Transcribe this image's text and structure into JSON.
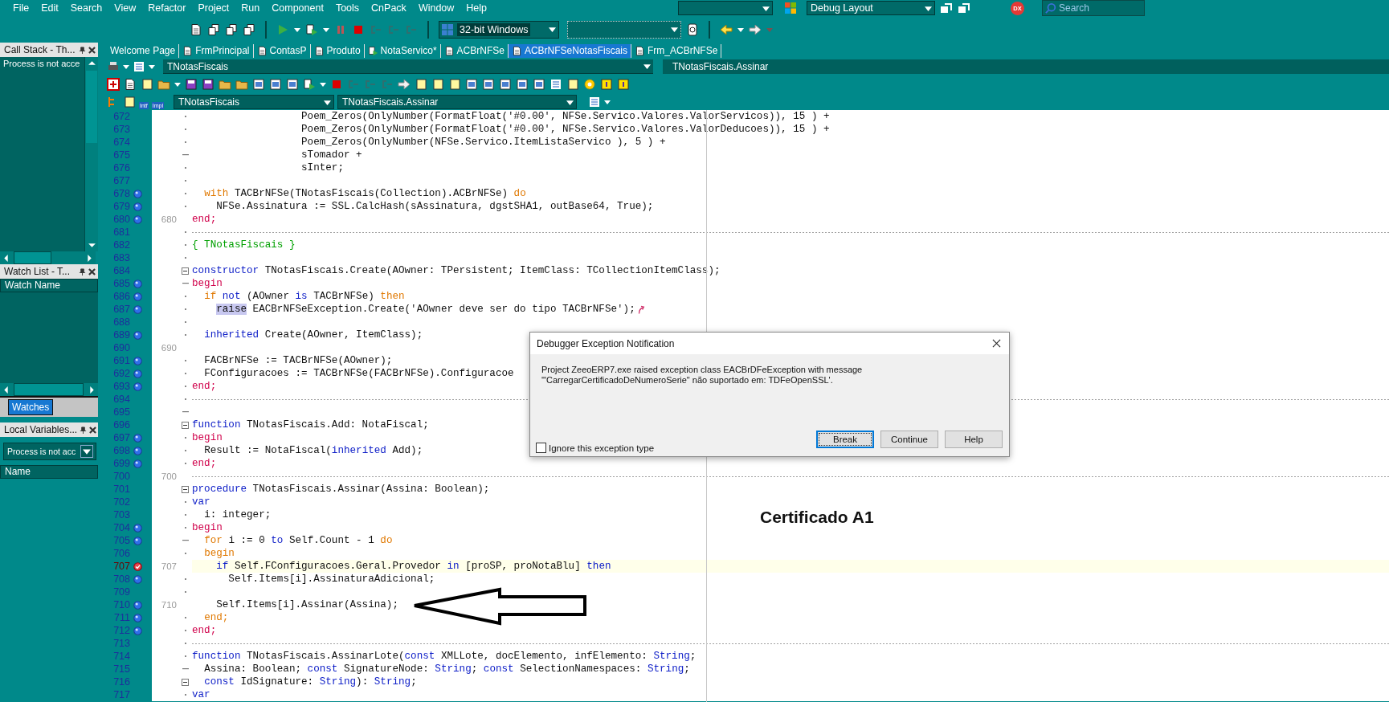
{
  "menu": [
    "File",
    "Edit",
    "Search",
    "View",
    "Refactor",
    "Project",
    "Run",
    "Component",
    "Tools",
    "CnPack",
    "Window",
    "Help"
  ],
  "top_right": {
    "layout_combo": "Debug Layout",
    "dx_badge": "DX",
    "search": {
      "placeholder": "Search"
    }
  },
  "toolbar": {
    "platform_combo": "32-bit Windows"
  },
  "tabs": [
    {
      "label": "Welcome Page",
      "kind": "plain",
      "selected": false
    },
    {
      "label": "FrmPrincipal",
      "kind": "form",
      "selected": false
    },
    {
      "label": "ContasP",
      "kind": "form",
      "selected": false
    },
    {
      "label": "Produto",
      "kind": "form",
      "selected": false
    },
    {
      "label": "NotaServico*",
      "kind": "edited",
      "selected": false
    },
    {
      "label": "ACBrNFSe",
      "kind": "unit",
      "selected": false
    },
    {
      "label": "ACBrNFSeNotasFiscais",
      "kind": "unit",
      "selected": true
    },
    {
      "label": "Frm_ACBrNFSe",
      "kind": "unit",
      "selected": false
    }
  ],
  "left": {
    "call_stack": {
      "title": "Call Stack - Th...",
      "message": "Process is not acce"
    },
    "watch_list": {
      "title": "Watch List - T...",
      "column": "Watch Name",
      "tabs": [
        {
          "label": "Watches",
          "selected": true
        }
      ]
    },
    "local_variables": {
      "title": "Local Variables...",
      "combo": "Process is not acc",
      "column": "Name"
    }
  },
  "editor": {
    "unit_combo": "TNotasFiscais",
    "method_label": "TNotasFiscais.Assinar",
    "nav_icons": [
      "Intf",
      "Impl"
    ],
    "class_combo": "TNotasFiscais",
    "method_combo": "TNotasFiscais.Assinar",
    "lines": [
      {
        "n": "672",
        "fold": {
          "kind": "dot"
        },
        "current": false,
        "code": [
          {
            "kind": "plain",
            "text": "                  Poem_Zeros(OnlyNumber(FormatFloat('#0.00', NFSe.Servico.Valores.ValorServicos)), 15 ) +"
          }
        ]
      },
      {
        "n": "673",
        "fold": {
          "kind": "dot"
        },
        "current": false,
        "code": [
          {
            "kind": "plain",
            "text": "                  Poem_Zeros(OnlyNumber(FormatFloat('#0.00', NFSe.Servico.Valores.ValorDeducoes)), 15 ) +"
          }
        ]
      },
      {
        "n": "674",
        "fold": {
          "kind": "dot"
        },
        "current": false,
        "code": [
          {
            "kind": "plain",
            "text": "                  Poem_Zeros(OnlyNumber(NFSe.Servico.ItemListaServico ), 5 ) +"
          }
        ]
      },
      {
        "n": "675",
        "fold": {
          "kind": "dash"
        },
        "current": false,
        "code": [
          {
            "kind": "plain",
            "text": "                  sTomador +"
          }
        ]
      },
      {
        "n": "676",
        "fold": {
          "kind": "dot"
        },
        "current": false,
        "code": [
          {
            "kind": "plain",
            "text": "                  sInter;"
          }
        ]
      },
      {
        "n": "677",
        "fold": {
          "kind": "dot"
        },
        "current": false
      },
      {
        "n": "678",
        "marker": {
          "kind": "dot"
        },
        "fold": {
          "kind": "dot"
        },
        "current": false,
        "code": [
          {
            "kind": "ctl",
            "text": "  with"
          },
          {
            "kind": "plain",
            "text": " TACBrNFSe(TNotasFiscais(Collection).ACBrNFSe) "
          },
          {
            "kind": "ctl",
            "text": "do"
          }
        ]
      },
      {
        "n": "679",
        "marker": {
          "kind": "dot"
        },
        "fold": {
          "kind": "dot"
        },
        "current": false,
        "code": [
          {
            "kind": "plain",
            "text": "    NFSe.Assinatura := SSL.CalcHash(sAssinatura, dgstSHA1, outBase64, True);"
          }
        ]
      },
      {
        "n": "680",
        "marker": {
          "kind": "dot"
        },
        "label": "680",
        "current": false,
        "code": [
          {
            "kind": "blk",
            "text": "end;"
          }
        ]
      },
      {
        "n": "681",
        "fold": {
          "kind": "dot"
        },
        "separator": true,
        "current": false
      },
      {
        "n": "682",
        "fold": {
          "kind": "dot"
        },
        "current": false,
        "code": [
          {
            "kind": "cmt",
            "text": "{ TNotasFiscais }"
          }
        ]
      },
      {
        "n": "683",
        "fold": {
          "kind": "dot"
        },
        "current": false
      },
      {
        "n": "684",
        "fold": {
          "kind": "box"
        },
        "current": false,
        "code": [
          {
            "kind": "kw",
            "text": "constructor"
          },
          {
            "kind": "plain",
            "text": " TNotasFiscais.Create(AOwner: TPersistent; ItemClass: TCollectionItemClass);"
          }
        ]
      },
      {
        "n": "685",
        "marker": {
          "kind": "dot"
        },
        "fold": {
          "kind": "dash"
        },
        "current": false,
        "code": [
          {
            "kind": "blk",
            "text": "begin"
          }
        ]
      },
      {
        "n": "686",
        "marker": {
          "kind": "dot"
        },
        "fold": {
          "kind": "dot"
        },
        "current": false,
        "code": [
          {
            "kind": "ctl",
            "text": "  if"
          },
          {
            "kind": "kw",
            "text": " not"
          },
          {
            "kind": "plain",
            "text": " (AOwner "
          },
          {
            "kind": "kw",
            "text": "is"
          },
          {
            "kind": "plain",
            "text": " TACBrNFSe) "
          },
          {
            "kind": "ctl",
            "text": "then"
          }
        ]
      },
      {
        "n": "687",
        "marker": {
          "kind": "dot"
        },
        "fold": {
          "kind": "dot"
        },
        "trail": {
          "kind": "arrow"
        },
        "current": false,
        "code": [
          {
            "kind": "hl",
            "text": "    raise"
          },
          {
            "kind": "plain",
            "text": " EACBrNFSeException.Create('AOwner deve ser do tipo TACBrNFSe');"
          }
        ]
      },
      {
        "n": "688",
        "fold": {
          "kind": "dot"
        },
        "current": false
      },
      {
        "n": "689",
        "marker": {
          "kind": "dot"
        },
        "fold": {
          "kind": "dot"
        },
        "current": false,
        "code": [
          {
            "kind": "kw",
            "text": "  inherited"
          },
          {
            "kind": "plain",
            "text": " Create(AOwner, ItemClass);"
          }
        ]
      },
      {
        "n": "690",
        "label": "690",
        "current": false
      },
      {
        "n": "691",
        "marker": {
          "kind": "dot"
        },
        "fold": {
          "kind": "dot"
        },
        "current": false,
        "code": [
          {
            "kind": "plain",
            "text": "  FACBrNFSe := TACBrNFSe(AOwner);"
          }
        ]
      },
      {
        "n": "692",
        "marker": {
          "kind": "dot"
        },
        "fold": {
          "kind": "dot"
        },
        "current": false,
        "code": [
          {
            "kind": "plain",
            "text": "  FConfiguracoes := TACBrNFSe(FACBrNFSe).Configuracoe"
          }
        ]
      },
      {
        "n": "693",
        "marker": {
          "kind": "dot"
        },
        "fold": {
          "kind": "dot"
        },
        "current": false,
        "code": [
          {
            "kind": "blk",
            "text": "end;"
          }
        ]
      },
      {
        "n": "694",
        "fold": {
          "kind": "dot"
        },
        "separator": true,
        "current": false
      },
      {
        "n": "695",
        "fold": {
          "kind": "dash"
        },
        "current": false
      },
      {
        "n": "696",
        "fold": {
          "kind": "box"
        },
        "current": false,
        "code": [
          {
            "kind": "kw",
            "text": "function"
          },
          {
            "kind": "plain",
            "text": " TNotasFiscais.Add: NotaFiscal;"
          }
        ]
      },
      {
        "n": "697",
        "marker": {
          "kind": "dot"
        },
        "fold": {
          "kind": "dot"
        },
        "current": false,
        "code": [
          {
            "kind": "blk",
            "text": "begin"
          }
        ]
      },
      {
        "n": "698",
        "marker": {
          "kind": "dot"
        },
        "fold": {
          "kind": "dot"
        },
        "current": false,
        "code": [
          {
            "kind": "plain",
            "text": "  Result := NotaFiscal("
          },
          {
            "kind": "kw",
            "text": "inherited"
          },
          {
            "kind": "plain",
            "text": " Add);"
          }
        ]
      },
      {
        "n": "699",
        "marker": {
          "kind": "dot"
        },
        "fold": {
          "kind": "dot"
        },
        "current": false,
        "code": [
          {
            "kind": "blk",
            "text": "end;"
          }
        ]
      },
      {
        "n": "700",
        "label": "700",
        "separator": true,
        "current": false
      },
      {
        "n": "701",
        "fold": {
          "kind": "box"
        },
        "current": false,
        "code": [
          {
            "kind": "kw",
            "text": "procedure"
          },
          {
            "kind": "plain",
            "text": " TNotasFiscais.Assinar(Assina: Boolean);"
          }
        ]
      },
      {
        "n": "702",
        "fold": {
          "kind": "dot"
        },
        "current": false,
        "code": [
          {
            "kind": "kw",
            "text": "var"
          }
        ]
      },
      {
        "n": "703",
        "fold": {
          "kind": "dot"
        },
        "current": false,
        "code": [
          {
            "kind": "plain",
            "text": "  i: integer;"
          }
        ]
      },
      {
        "n": "704",
        "marker": {
          "kind": "dot"
        },
        "fold": {
          "kind": "dot"
        },
        "current": false,
        "code": [
          {
            "kind": "blk",
            "text": "begin"
          }
        ]
      },
      {
        "n": "705",
        "marker": {
          "kind": "dot"
        },
        "fold": {
          "kind": "dash"
        },
        "current": false,
        "code": [
          {
            "kind": "ctl",
            "text": "  for"
          },
          {
            "kind": "plain",
            "text": " i := 0 "
          },
          {
            "kind": "kw",
            "text": "to"
          },
          {
            "kind": "plain",
            "text": " Self.Count - 1 "
          },
          {
            "kind": "ctl",
            "text": "do"
          }
        ]
      },
      {
        "n": "706",
        "fold": {
          "kind": "dot"
        },
        "current": false,
        "code": [
          {
            "kind": "ctl",
            "text": "  begin"
          }
        ]
      },
      {
        "n": "707",
        "marker": {
          "kind": "breakpoint"
        },
        "label": "707",
        "current": true,
        "code": [
          {
            "kind": "kw",
            "text": "    if"
          },
          {
            "kind": "plain",
            "text": " Self.FConfiguracoes.Geral.Provedor "
          },
          {
            "kind": "kw",
            "text": "in"
          },
          {
            "kind": "plain",
            "text": " [proSP, proNotaBlu] "
          },
          {
            "kind": "kw",
            "text": "then"
          }
        ]
      },
      {
        "n": "708",
        "marker": {
          "kind": "dot"
        },
        "fold": {
          "kind": "dot"
        },
        "current": false,
        "code": [
          {
            "kind": "plain",
            "text": "      Self.Items[i].AssinaturaAdicional;"
          }
        ]
      },
      {
        "n": "709",
        "fold": {
          "kind": "dot"
        },
        "current": false
      },
      {
        "n": "710",
        "marker": {
          "kind": "dot"
        },
        "label": "710",
        "current": false,
        "code": [
          {
            "kind": "plain",
            "text": "    Self.Items[i].Assinar(Assina);"
          }
        ]
      },
      {
        "n": "711",
        "marker": {
          "kind": "dot"
        },
        "fold": {
          "kind": "dot"
        },
        "current": false,
        "code": [
          {
            "kind": "ctl",
            "text": "  end;"
          }
        ]
      },
      {
        "n": "712",
        "marker": {
          "kind": "dot"
        },
        "fold": {
          "kind": "dot"
        },
        "current": false,
        "code": [
          {
            "kind": "blk",
            "text": "end;"
          }
        ]
      },
      {
        "n": "713",
        "fold": {
          "kind": "dot"
        },
        "separator": true,
        "current": false
      },
      {
        "n": "714",
        "fold": {
          "kind": "dot"
        },
        "current": false,
        "code": [
          {
            "kind": "kw",
            "text": "function"
          },
          {
            "kind": "plain",
            "text": " TNotasFiscais.AssinarLote("
          },
          {
            "kind": "kw",
            "text": "const"
          },
          {
            "kind": "plain",
            "text": " XMLLote, docElemento, infElemento: "
          },
          {
            "kind": "kw",
            "text": "String"
          },
          {
            "kind": "plain",
            "text": ";"
          }
        ]
      },
      {
        "n": "715",
        "fold": {
          "kind": "dash"
        },
        "current": false,
        "code": [
          {
            "kind": "plain",
            "text": "  Assina: Boolean; "
          },
          {
            "kind": "kw",
            "text": "const"
          },
          {
            "kind": "plain",
            "text": " SignatureNode: "
          },
          {
            "kind": "kw",
            "text": "String"
          },
          {
            "kind": "plain",
            "text": "; "
          },
          {
            "kind": "kw",
            "text": "const"
          },
          {
            "kind": "plain",
            "text": " SelectionNamespaces: "
          },
          {
            "kind": "kw",
            "text": "String"
          },
          {
            "kind": "plain",
            "text": ";"
          }
        ]
      },
      {
        "n": "716",
        "fold": {
          "kind": "box"
        },
        "current": false,
        "code": [
          {
            "kind": "kw",
            "text": "  const"
          },
          {
            "kind": "plain",
            "text": " IdSignature: "
          },
          {
            "kind": "kw",
            "text": "String"
          },
          {
            "kind": "plain",
            "text": "): "
          },
          {
            "kind": "kw",
            "text": "String"
          },
          {
            "kind": "plain",
            "text": ";"
          }
        ]
      },
      {
        "n": "717",
        "fold": {
          "kind": "dot"
        },
        "current": false,
        "code": [
          {
            "kind": "kw",
            "text": "var"
          }
        ]
      }
    ]
  },
  "annotation": "Certificado A1",
  "dialog": {
    "title": "Debugger Exception Notification",
    "message": [
      "Project ZeeoERP7.exe raised exception class EACBrDFeException with message",
      "'\"CarregarCertificadoDeNumeroSerie\" não suportado em: TDFeOpenSSL'."
    ],
    "checkbox": {
      "label": "Ignore this exception type",
      "checked": false
    },
    "buttons": [
      {
        "label": "Break",
        "default": true
      },
      {
        "label": "Continue",
        "default": false
      },
      {
        "label": "Help",
        "default": false
      }
    ]
  }
}
